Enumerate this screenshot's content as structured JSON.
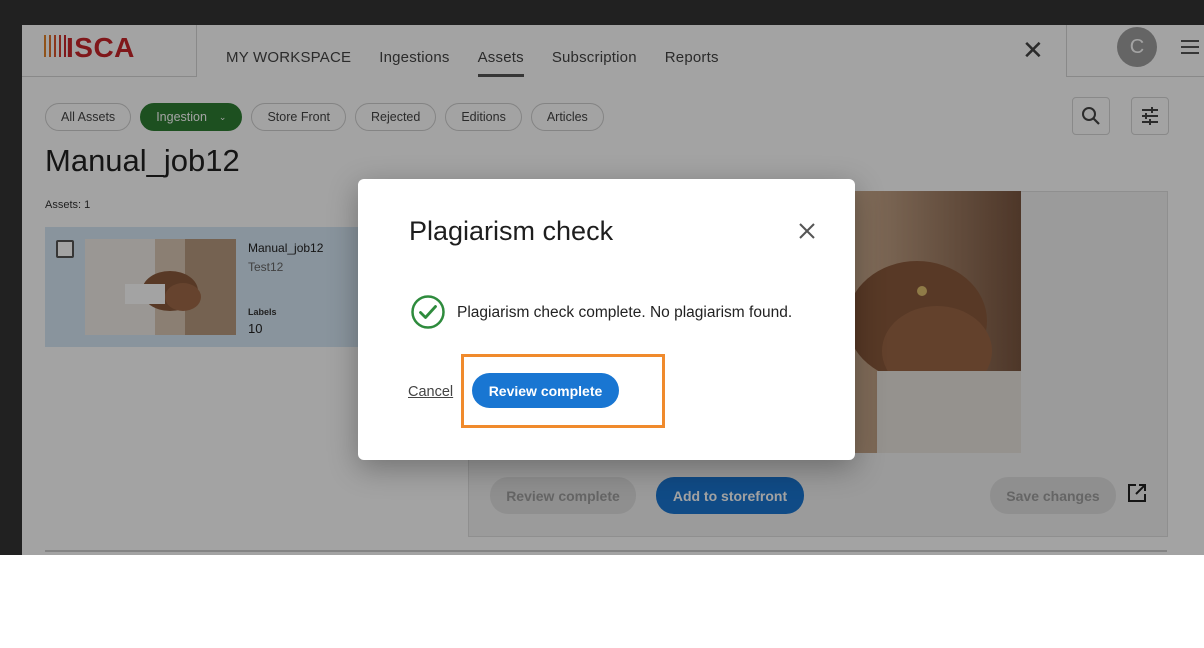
{
  "top_strip": {
    "text": ""
  },
  "logo": {
    "text": "ISCA"
  },
  "nav": {
    "items": [
      "MY WORKSPACE",
      "Ingestions",
      "Assets",
      "Subscription",
      "Reports"
    ],
    "active": "Assets"
  },
  "header": {
    "avatar_initial": "C"
  },
  "filters": {
    "chips": [
      "All Assets",
      "Ingestion",
      "Store Front",
      "Rejected",
      "Editions",
      "Articles"
    ],
    "active": "Ingestion"
  },
  "page": {
    "title": "Manual_job12",
    "assets_count": "Assets: 1"
  },
  "asset": {
    "name": "Manual_job12",
    "subtitle": "Test12",
    "labels_key": "Labels",
    "labels_value": "10"
  },
  "detail": {
    "review_complete_label": "Review complete",
    "add_to_storefront_label": "Add to storefront",
    "save_changes_label": "Save changes"
  },
  "dialog": {
    "title": "Plagiarism check",
    "message": "Plagiarism check complete. No plagiarism found.",
    "cancel_label": "Cancel",
    "review_label": "Review complete"
  },
  "colors": {
    "accent": "#1976d2",
    "active_chip": "#2e7d32",
    "highlight": "#f08a2c",
    "brand": "#c8242a"
  },
  "icons": [
    "close-icon",
    "search-icon",
    "filter-settings-icon",
    "menu-icon",
    "checkmark-circle-icon",
    "external-link-icon",
    "chevron-down-icon"
  ]
}
